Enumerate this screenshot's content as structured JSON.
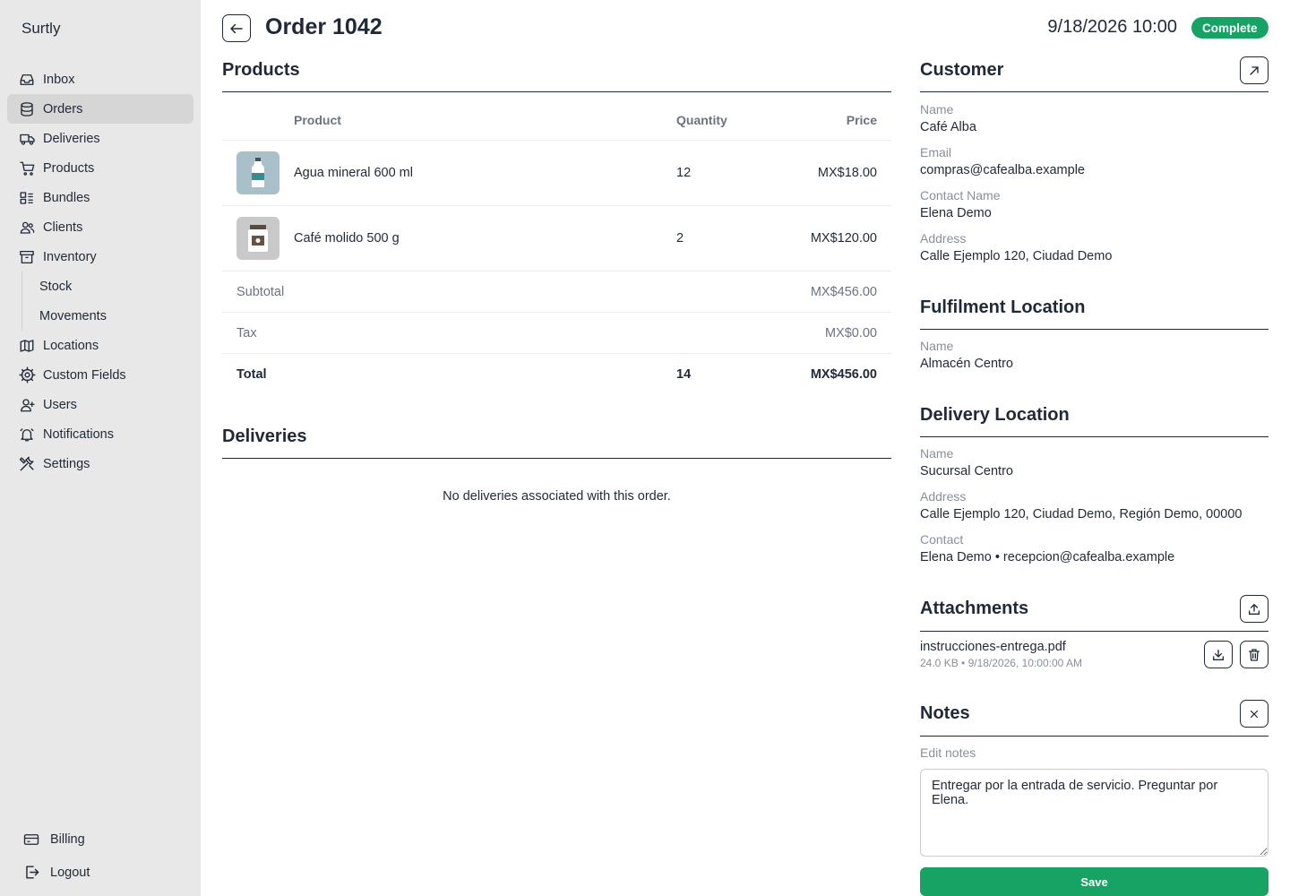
{
  "app": {
    "brand": "Surtly"
  },
  "sidebar": {
    "items": [
      {
        "label": "Inbox",
        "icon": "inbox-icon"
      },
      {
        "label": "Orders",
        "icon": "database-icon",
        "active": true
      },
      {
        "label": "Deliveries",
        "icon": "truck-icon"
      },
      {
        "label": "Products",
        "icon": "cart-icon"
      },
      {
        "label": "Bundles",
        "icon": "bundles-icon"
      },
      {
        "label": "Clients",
        "icon": "users-icon"
      },
      {
        "label": "Inventory",
        "icon": "archive-icon"
      }
    ],
    "inventory_sub": [
      {
        "label": "Stock"
      },
      {
        "label": "Movements"
      }
    ],
    "items2": [
      {
        "label": "Locations",
        "icon": "map-icon"
      },
      {
        "label": "Custom Fields",
        "icon": "cog-icon"
      },
      {
        "label": "Users",
        "icon": "user-plus-icon"
      },
      {
        "label": "Notifications",
        "icon": "bell-icon"
      },
      {
        "label": "Settings",
        "icon": "tools-icon"
      }
    ],
    "bottom": [
      {
        "label": "Billing",
        "icon": "credit-card-icon"
      },
      {
        "label": "Logout",
        "icon": "logout-icon"
      }
    ]
  },
  "header": {
    "title": "Order 1042",
    "datetime": "9/18/2026 10:00",
    "status": "Complete",
    "status_color": "#16a364"
  },
  "products": {
    "title": "Products",
    "columns": {
      "product": "Product",
      "quantity": "Quantity",
      "price": "Price"
    },
    "rows": [
      {
        "name": "Agua mineral 600 ml",
        "quantity": "12",
        "price": "MX$18.00",
        "icon": "water-bottle-icon"
      },
      {
        "name": "Café molido 500 g",
        "quantity": "2",
        "price": "MX$120.00",
        "icon": "coffee-jar-icon"
      }
    ],
    "subtotal_label": "Subtotal",
    "subtotal": "MX$456.00",
    "tax_label": "Tax",
    "tax": "MX$0.00",
    "total_label": "Total",
    "total_qty": "14",
    "total": "MX$456.00"
  },
  "deliveries": {
    "title": "Deliveries",
    "empty": "No deliveries associated with this order."
  },
  "customer": {
    "title": "Customer",
    "name_label": "Name",
    "name": "Café Alba",
    "email_label": "Email",
    "email": "compras@cafealba.example",
    "contact_label": "Contact Name",
    "contact": "Elena Demo",
    "address_label": "Address",
    "address": "Calle Ejemplo 120, Ciudad Demo"
  },
  "fulfilment": {
    "title": "Fulfilment Location",
    "name_label": "Name",
    "name": "Almacén Centro"
  },
  "delivery_location": {
    "title": "Delivery Location",
    "name_label": "Name",
    "name": "Sucursal Centro",
    "address_label": "Address",
    "address": "Calle Ejemplo 120, Ciudad Demo, Región Demo, 00000",
    "contact_label": "Contact",
    "contact": "Elena Demo • recepcion@cafealba.example"
  },
  "attachments": {
    "title": "Attachments",
    "files": [
      {
        "name": "instrucciones-entrega.pdf",
        "meta": "24.0 KB • 9/18/2026, 10:00:00 AM"
      }
    ]
  },
  "notes": {
    "title": "Notes",
    "label": "Edit notes",
    "value": "Entregar por la entrada de servicio. Preguntar por Elena.",
    "save_label": "Save"
  }
}
